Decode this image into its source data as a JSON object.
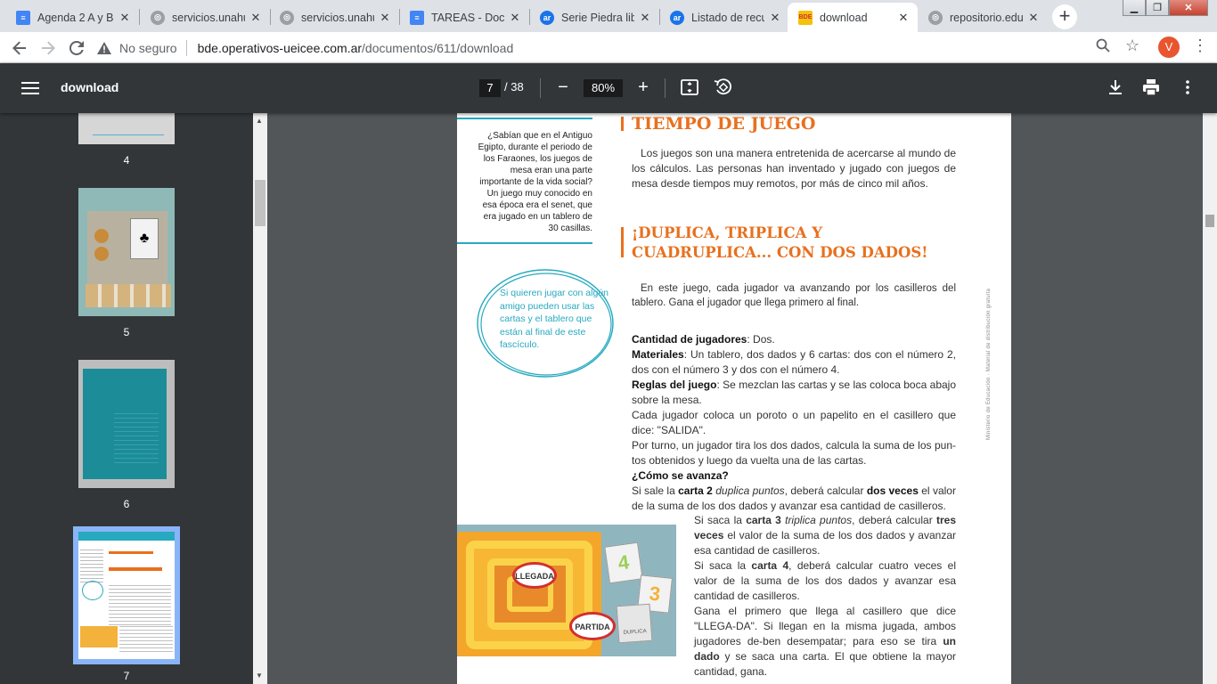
{
  "tabs": [
    {
      "label": "Agenda 2 A y B",
      "icon": "docs-icon",
      "color": "#4285f4"
    },
    {
      "label": "servicios.unahur",
      "icon": "globe-icon",
      "color": "#5f6368"
    },
    {
      "label": "servicios.unahur",
      "icon": "globe-icon",
      "color": "#5f6368"
    },
    {
      "label": "TAREAS - Docu",
      "icon": "docs-icon",
      "color": "#4285f4"
    },
    {
      "label": "Serie Piedra libre",
      "icon": "ar-icon",
      "color": "#1a73e8"
    },
    {
      "label": "Listado de recu",
      "icon": "ar-icon",
      "color": "#1a73e8"
    },
    {
      "label": "download",
      "icon": "bde-icon",
      "color": "#f4c20d",
      "active": true
    },
    {
      "label": "repositorio.edu",
      "icon": "globe-icon",
      "color": "#5f6368"
    }
  ],
  "tab_close_glyph": "✕",
  "new_tab_glyph": "+",
  "address": {
    "security_label": "No seguro",
    "host": "bde.operativos-ueicee.com.ar",
    "path": "/documentos/611/download"
  },
  "profile_initial": "V",
  "pdf": {
    "title": "download",
    "current_page": "7",
    "page_total": "/ 38",
    "zoom": "80%"
  },
  "thumbnails": [
    {
      "number": "4"
    },
    {
      "number": "5"
    },
    {
      "number": "6"
    },
    {
      "number": "7"
    }
  ],
  "page_content": {
    "side_note": "¿Sabían que en el Antiguo Egipto, durante el periodo de los Faraones, los juegos de mesa eran una parte importante de la vida social? Un juego muy conocido en esa época era el senet, que era jugado en un tablero de 30 casillas.",
    "circle_note": "Si quieren jugar con algún amigo pueden usar las cartas y el tablero que están al final de este fascículo.",
    "heading1": "TIEMPO DE JUEGO",
    "intro1": "Los juegos son una manera entretenida de acercarse al mundo de los cálculos. Las personas han inventado y jugado con juegos de mesa desde tiempos muy remotos, por más de cinco mil años.",
    "heading2_line1": "¡DUPLICA, TRIPLICA Y",
    "heading2_line2": "CUADRUPLICA... CON DOS DADOS!",
    "intro2": "En este juego, cada jugador va avanzando por los casilleros del tablero. Gana el jugador que llega primero al final.",
    "players_label": "Cantidad de jugadores",
    "players_value": ": Dos.",
    "materials_label": "Materiales",
    "materials_value": ": Un tablero, dos dados y 6 cartas: dos con el número 2, dos con el número 3 y dos con el número 4.",
    "rules_label": "Reglas del juego",
    "rules_value": ": Se mezclan las cartas y se las coloca boca abajo sobre la mesa.",
    "rule2": "Cada jugador coloca un poroto o un papelito en el casillero que dice: \"SALIDA\".",
    "rule3": "Por turno, un jugador tira los dos dados, calcula la suma de los pun-tos obtenidos y luego da vuelta una de las cartas.",
    "advance_label": "¿Cómo se avanza?",
    "card2_a": "Si sale la ",
    "card2_b": "carta 2",
    "card2_c": " duplica puntos",
    "card2_d": ", deberá calcular ",
    "card2_e": "dos veces",
    "card2_f": " el valor de la suma de los dos dados y avanzar esa cantidad de casilleros.",
    "card3_a": "Si saca la ",
    "card3_b": "carta 3",
    "card3_c": " triplica puntos",
    "card3_d": ", deberá calcular ",
    "card3_e": "tres veces",
    "card3_f": " el valor de la suma de los dos dados y avanzar esa cantidad de casilleros.",
    "card4_a": "Si saca la ",
    "card4_b": "carta 4",
    "card4_c": ", deberá calcular cuatro veces el valor de la suma de los dos dados y avanzar esa cantidad de casilleros.",
    "winner_a": "Gana el primero que llega al casillero que dice \"LLEGA-DA\". Si llegan en la misma jugada, ambos jugadores de-ben desempatar; para eso se tira ",
    "winner_b": "un dado",
    "winner_c": " y se saca una carta. El que obtiene la mayor cantidad, gana.",
    "vertical_credit": "Ministerio de Educación · Material de distribución gratuita",
    "board_label_llegada": "LLEGADA",
    "board_label_partida": "PARTIDA",
    "card_labels": [
      "4",
      "3",
      "DUPLICA"
    ]
  },
  "colors": {
    "teal": "#27a9bf",
    "orange": "#e8701e",
    "pdf_toolbar": "#323639",
    "viewer_bg": "#525659"
  }
}
